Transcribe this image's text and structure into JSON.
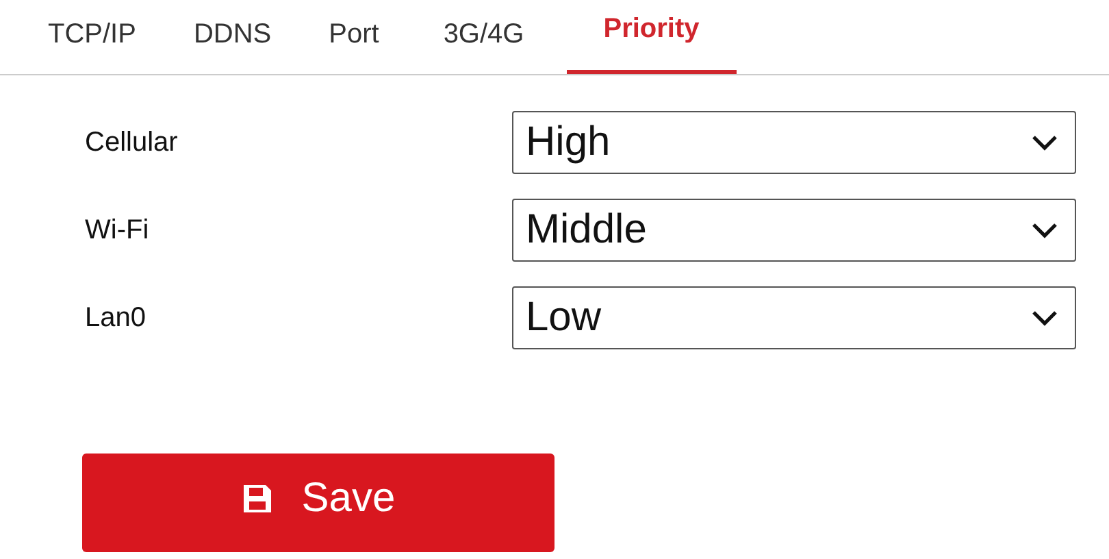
{
  "tabs": [
    {
      "label": "TCP/IP",
      "selected": false
    },
    {
      "label": "DDNS",
      "selected": false
    },
    {
      "label": "Port",
      "selected": false
    },
    {
      "label": "3G/4G",
      "selected": false
    },
    {
      "label": "Priority",
      "selected": true
    }
  ],
  "priorities": [
    {
      "label": "Cellular",
      "value": "High"
    },
    {
      "label": "Wi-Fi",
      "value": "Middle"
    },
    {
      "label": "Lan0",
      "value": "Low"
    }
  ],
  "save_button": "Save"
}
